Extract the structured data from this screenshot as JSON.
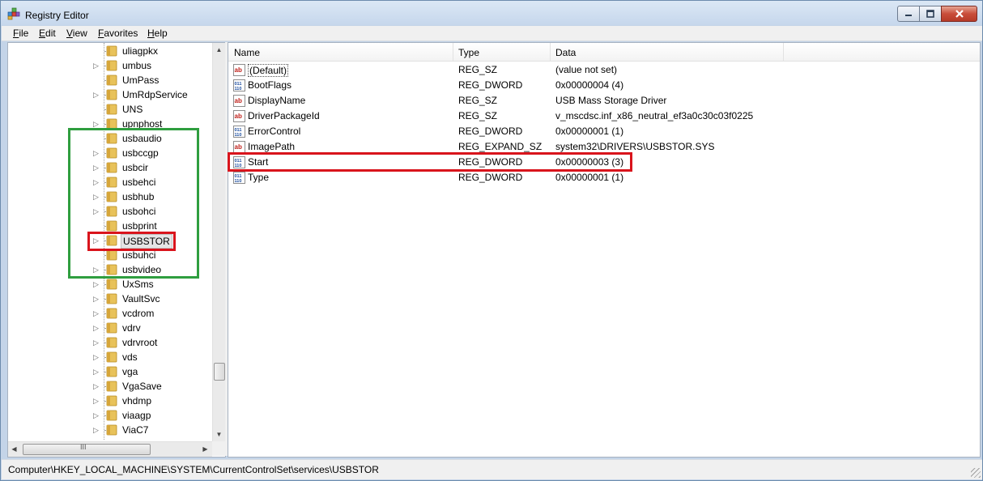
{
  "window": {
    "title": "Registry Editor",
    "icon": "registry-editor-icon"
  },
  "menu": [
    {
      "label": "File",
      "accel": "F",
      "rest": "ile"
    },
    {
      "label": "Edit",
      "accel": "E",
      "rest": "dit"
    },
    {
      "label": "View",
      "accel": "V",
      "rest": "iew"
    },
    {
      "label": "Favorites",
      "accel": "F",
      "rest": "avorites"
    },
    {
      "label": "Help",
      "accel": "H",
      "rest": "elp"
    }
  ],
  "tree": {
    "nodes": [
      {
        "label": "uliagpkx",
        "expandable": false
      },
      {
        "label": "umbus",
        "expandable": true
      },
      {
        "label": "UmPass",
        "expandable": false
      },
      {
        "label": "UmRdpService",
        "expandable": true
      },
      {
        "label": "UNS",
        "expandable": false
      },
      {
        "label": "upnphost",
        "expandable": true
      },
      {
        "label": "usbaudio",
        "expandable": false
      },
      {
        "label": "usbccgp",
        "expandable": true
      },
      {
        "label": "usbcir",
        "expandable": true
      },
      {
        "label": "usbehci",
        "expandable": true
      },
      {
        "label": "usbhub",
        "expandable": true
      },
      {
        "label": "usbohci",
        "expandable": true
      },
      {
        "label": "usbprint",
        "expandable": false
      },
      {
        "label": "USBSTOR",
        "expandable": true,
        "selected": true
      },
      {
        "label": "usbuhci",
        "expandable": false
      },
      {
        "label": "usbvideo",
        "expandable": true
      },
      {
        "label": "UxSms",
        "expandable": true
      },
      {
        "label": "VaultSvc",
        "expandable": true
      },
      {
        "label": "vcdrom",
        "expandable": true
      },
      {
        "label": "vdrv",
        "expandable": true
      },
      {
        "label": "vdrvroot",
        "expandable": true
      },
      {
        "label": "vds",
        "expandable": true
      },
      {
        "label": "vga",
        "expandable": true
      },
      {
        "label": "VgaSave",
        "expandable": true
      },
      {
        "label": "vhdmp",
        "expandable": true
      },
      {
        "label": "viaagp",
        "expandable": true
      },
      {
        "label": "ViaC7",
        "expandable": true
      }
    ]
  },
  "list": {
    "columns": [
      "Name",
      "Type",
      "Data"
    ],
    "rows": [
      {
        "name": "(Default)",
        "type": "REG_SZ",
        "data": "(value not set)",
        "icon": "string-value-icon"
      },
      {
        "name": "BootFlags",
        "type": "REG_DWORD",
        "data": "0x00000004 (4)",
        "icon": "binary-value-icon"
      },
      {
        "name": "DisplayName",
        "type": "REG_SZ",
        "data": "USB Mass Storage Driver",
        "icon": "string-value-icon"
      },
      {
        "name": "DriverPackageId",
        "type": "REG_SZ",
        "data": "v_mscdsc.inf_x86_neutral_ef3a0c30c03f0225",
        "icon": "string-value-icon"
      },
      {
        "name": "ErrorControl",
        "type": "REG_DWORD",
        "data": "0x00000001 (1)",
        "icon": "binary-value-icon"
      },
      {
        "name": "ImagePath",
        "type": "REG_EXPAND_SZ",
        "data": "system32\\DRIVERS\\USBSTOR.SYS",
        "icon": "string-value-icon"
      },
      {
        "name": "Start",
        "type": "REG_DWORD",
        "data": "0x00000003 (3)",
        "icon": "binary-value-icon"
      },
      {
        "name": "Type",
        "type": "REG_DWORD",
        "data": "0x00000001 (1)",
        "icon": "binary-value-icon"
      }
    ]
  },
  "status": {
    "path": "Computer\\HKEY_LOCAL_MACHINE\\SYSTEM\\CurrentControlSet\\services\\USBSTOR"
  },
  "scrollbar": {
    "hscroll_grip": "III"
  },
  "colors": {
    "highlight_red": "#d9141c",
    "highlight_green": "#2f9e3f",
    "folder": "#e8c25a"
  }
}
